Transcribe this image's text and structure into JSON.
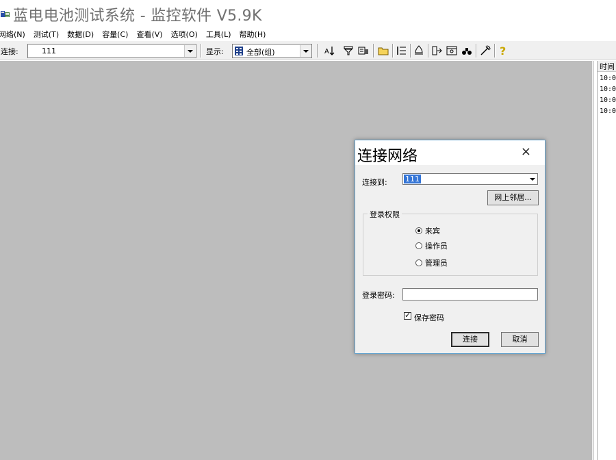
{
  "window": {
    "title": "蓝电电池测试系统 - 监控软件 V5.9K",
    "app_icon": "battery-app-icon"
  },
  "menu": [
    "网络(N)",
    "测试(T)",
    "数据(D)",
    "容量(C)",
    "查看(V)",
    "选项(O)",
    "工具(L)",
    "帮助(H)"
  ],
  "toolbar": {
    "connect_label": "连接:",
    "connect_value": "111",
    "display_label": "显示:",
    "display_value": "全部(组)",
    "buttons": [
      "sort-icon",
      "filter-icon",
      "channel-icon",
      "folder-icon",
      "list-icon",
      "bell-icon",
      "export-icon",
      "window-icon",
      "binoculars-icon",
      "tools-icon",
      "help-icon"
    ]
  },
  "side_panel": {
    "column_header": "时间",
    "rows": [
      "10:0",
      "10:0",
      "10:0",
      "10:0"
    ]
  },
  "dialog": {
    "title": "连接网络",
    "close_glyph": "×",
    "connect_to_label": "连接到:",
    "connect_to_value": "111",
    "browse_button": "网上邻居...",
    "group_title": "登录权限",
    "roles": [
      {
        "label": "来宾",
        "selected": true
      },
      {
        "label": "操作员",
        "selected": false
      },
      {
        "label": "管理员",
        "selected": false
      }
    ],
    "password_label": "登录密码:",
    "password_value": "",
    "save_password_label": "保存密码",
    "save_password_checked": true,
    "ok_button": "连接",
    "cancel_button": "取消",
    "accent_color": "#5fa0cd"
  }
}
